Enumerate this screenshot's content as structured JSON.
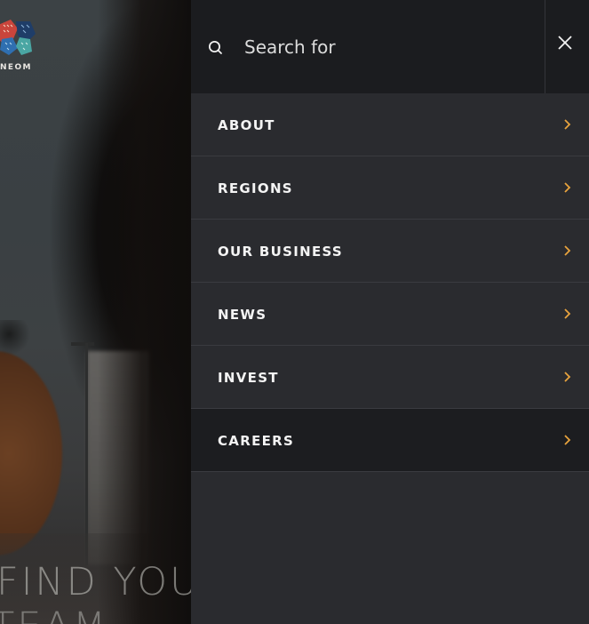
{
  "brand": {
    "name": "NEOM"
  },
  "hero": {
    "line1": "FIND YOU",
    "line2": "TEAM"
  },
  "search": {
    "placeholder": "Search for",
    "value": ""
  },
  "close_icon": "close-icon",
  "menu": {
    "items": [
      {
        "label": "ABOUT",
        "active": false
      },
      {
        "label": "REGIONS",
        "active": false
      },
      {
        "label": "OUR BUSINESS",
        "active": false
      },
      {
        "label": "NEWS",
        "active": false
      },
      {
        "label": "INVEST",
        "active": false
      },
      {
        "label": "CAREERS",
        "active": true
      }
    ]
  },
  "colors": {
    "panel_bg": "#2a2b2f",
    "search_bg": "#1b1c1f",
    "active_bg": "#1c1d20",
    "accent": "#e8a33d",
    "text": "#f4f4f4"
  }
}
